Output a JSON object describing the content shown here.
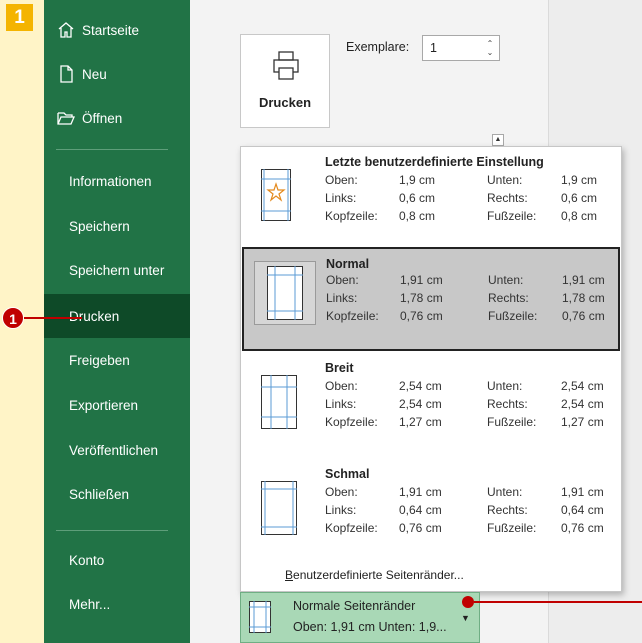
{
  "step_number": "1",
  "callout_number": "1",
  "colors": {
    "sidebar": "#217346",
    "sidebar_active": "#0E4A28",
    "accent_red": "#C00000",
    "badge": "#F4B400",
    "selected_bg": "#C8C8C8",
    "current_button_bg": "#A9D8B6"
  },
  "sidebar": {
    "top_items": [
      {
        "label": "Startseite",
        "icon": "home-icon"
      },
      {
        "label": "Neu",
        "icon": "new-document-icon"
      },
      {
        "label": "Öffnen",
        "icon": "open-folder-icon"
      }
    ],
    "items": [
      {
        "label": "Informationen"
      },
      {
        "label": "Speichern"
      },
      {
        "label": "Speichern unter"
      },
      {
        "label": "Drucken",
        "active": true
      },
      {
        "label": "Freigeben"
      },
      {
        "label": "Exportieren"
      },
      {
        "label": "Veröffentlichen"
      },
      {
        "label": "Schließen"
      }
    ],
    "bottom_items": [
      {
        "label": "Konto"
      },
      {
        "label": "Mehr..."
      }
    ]
  },
  "print": {
    "button_label": "Drucken",
    "copies_label": "Exemplare:",
    "copies_value": "1"
  },
  "margins_dropdown": {
    "options": [
      {
        "title": "Letzte benutzerdefinierte Einstellung",
        "oben_label": "Oben:",
        "oben": "1,9 cm",
        "unten_label": "Unten:",
        "unten": "1,9 cm",
        "links_label": "Links:",
        "links": "0,6 cm",
        "rechts_label": "Rechts:",
        "rechts": "0,6 cm",
        "kopf_label": "Kopfzeile:",
        "kopf": "0,8 cm",
        "fuss_label": "Fußzeile:",
        "fuss": "0,8 cm",
        "icon": "custom-margins-star-icon"
      },
      {
        "title": "Normal",
        "oben_label": "Oben:",
        "oben": "1,91 cm",
        "unten_label": "Unten:",
        "unten": "1,91 cm",
        "links_label": "Links:",
        "links": "1,78 cm",
        "rechts_label": "Rechts:",
        "rechts": "1,78 cm",
        "kopf_label": "Kopfzeile:",
        "kopf": "0,76 cm",
        "fuss_label": "Fußzeile:",
        "fuss": "0,76 cm",
        "icon": "normal-margins-icon",
        "selected": true
      },
      {
        "title": "Breit",
        "oben_label": "Oben:",
        "oben": "2,54 cm",
        "unten_label": "Unten:",
        "unten": "2,54 cm",
        "links_label": "Links:",
        "links": "2,54 cm",
        "rechts_label": "Rechts:",
        "rechts": "2,54 cm",
        "kopf_label": "Kopfzeile:",
        "kopf": "1,27 cm",
        "fuss_label": "Fußzeile:",
        "fuss": "1,27 cm",
        "icon": "wide-margins-icon"
      },
      {
        "title": "Schmal",
        "oben_label": "Oben:",
        "oben": "1,91 cm",
        "unten_label": "Unten:",
        "unten": "1,91 cm",
        "links_label": "Links:",
        "links": "0,64 cm",
        "rechts_label": "Rechts:",
        "rechts": "0,64 cm",
        "kopf_label": "Kopfzeile:",
        "kopf": "0,76 cm",
        "fuss_label": "Fußzeile:",
        "fuss": "0,76 cm",
        "icon": "narrow-margins-icon"
      }
    ],
    "custom_link_first": "B",
    "custom_link_rest": "enutzerdefinierte Seitenränder..."
  },
  "current_margins": {
    "line1": "Normale Seitenränder",
    "line2": "Oben: 1,91 cm Unten: 1,9..."
  }
}
